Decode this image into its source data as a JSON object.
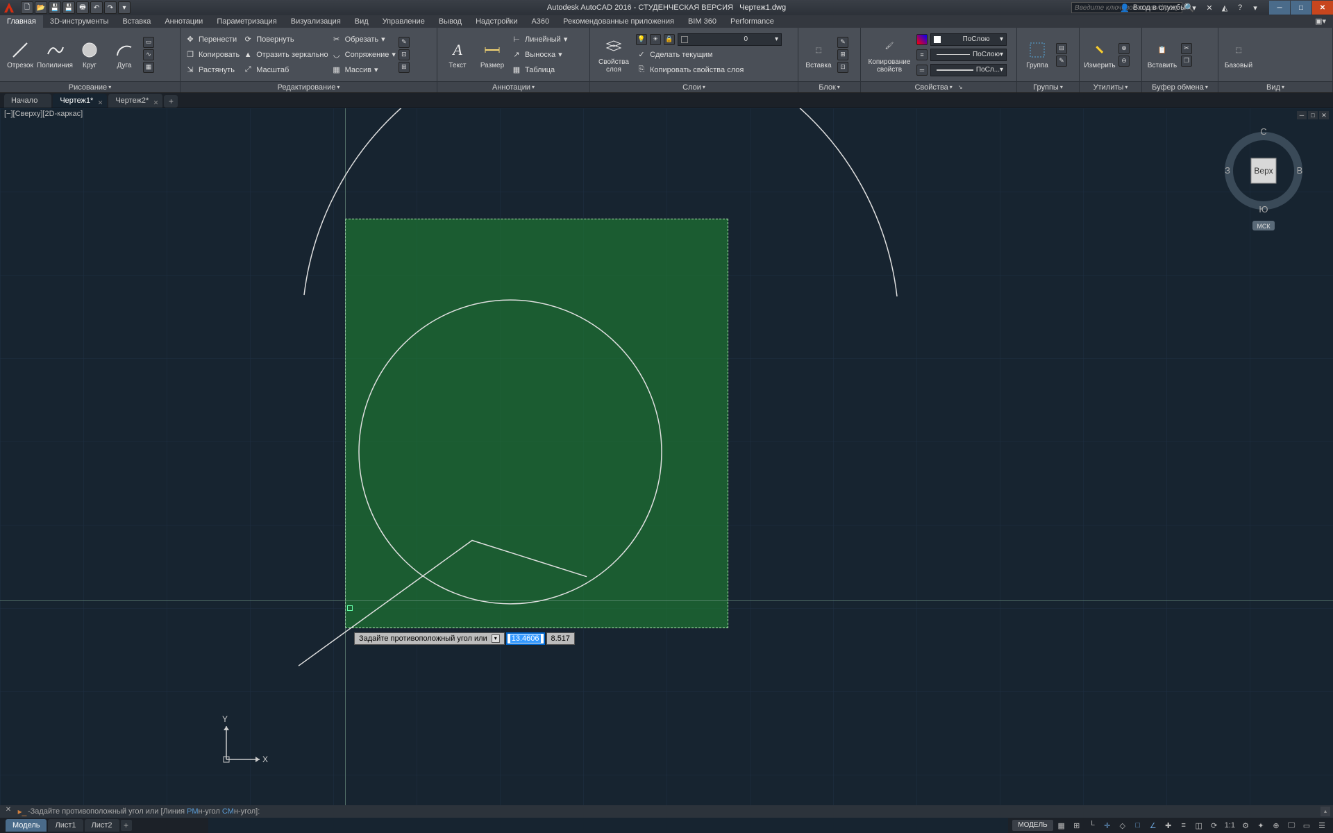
{
  "title": {
    "app": "Autodesk AutoCAD 2016 - СТУДЕНЧЕСКАЯ ВЕРСИЯ",
    "file": "Чертеж1.dwg",
    "search_placeholder": "Введите ключевое слово/фразу",
    "login": "Вход в службы"
  },
  "menu": [
    "Главная",
    "3D-инструменты",
    "Вставка",
    "Аннотации",
    "Параметризация",
    "Визуализация",
    "Вид",
    "Управление",
    "Вывод",
    "Надстройки",
    "A360",
    "Рекомендованные приложения",
    "BIM 360",
    "Performance"
  ],
  "ribbon": {
    "draw": {
      "title": "Рисование",
      "line": "Отрезок",
      "polyline": "Полилиния",
      "circle": "Круг",
      "arc": "Дуга"
    },
    "edit": {
      "title": "Редактирование",
      "move": "Перенести",
      "rotate": "Повернуть",
      "trim": "Обрезать",
      "copy": "Копировать",
      "mirror": "Отразить зеркально",
      "fillet": "Сопряжение",
      "stretch": "Растянуть",
      "scale": "Масштаб",
      "array": "Массив"
    },
    "annot": {
      "title": "Аннотации",
      "text": "Текст",
      "dim": "Размер",
      "linear": "Линейный",
      "leader": "Выноска",
      "table": "Таблица"
    },
    "layers": {
      "title": "Слои",
      "props": "Свойства\nслоя",
      "current_value": "0",
      "makecur": "Сделать текущим",
      "matchlayer": "Копировать свойства слоя"
    },
    "block": {
      "title": "Блок",
      "insert": "Вставка"
    },
    "props": {
      "title": "Свойства",
      "match": "Копирование\nсвойств",
      "bycolor": "ПоСлою",
      "byline": "ПоСлою",
      "bylw": "ПоСл..."
    },
    "groups": {
      "title": "Группы",
      "group": "Группа"
    },
    "utils": {
      "title": "Утилиты",
      "measure": "Измерить"
    },
    "clip": {
      "title": "Буфер обмена",
      "paste": "Вставить"
    },
    "view": {
      "title": "Вид",
      "base": "Базовый"
    }
  },
  "file_tabs": {
    "start": "Начало",
    "t1": "Чертеж1*",
    "t2": "Чертеж2*"
  },
  "view_label": "[−][Сверху][2D-каркас]",
  "viewcube": {
    "top": "Верх",
    "n": "С",
    "s": "Ю",
    "e": "В",
    "w": "З",
    "wcs": "МСК"
  },
  "dyn": {
    "prompt": "Задайте противоположный угол или",
    "v1": "13.4606",
    "v2": "8.517"
  },
  "cmd": {
    "prefix": "-Задайте противоположный угол или [",
    "opt1_pre": "Линия ",
    "opt1_hl": "РМ",
    "opt1_post": "н-угол ",
    "opt2_hl": "СМ",
    "opt2_post": "н-угол",
    "suffix": "]:"
  },
  "bottom_tabs": {
    "model": "Модель",
    "l1": "Лист1",
    "l2": "Лист2"
  },
  "status": {
    "model": "МОДЕЛЬ",
    "ratio": "1:1"
  }
}
